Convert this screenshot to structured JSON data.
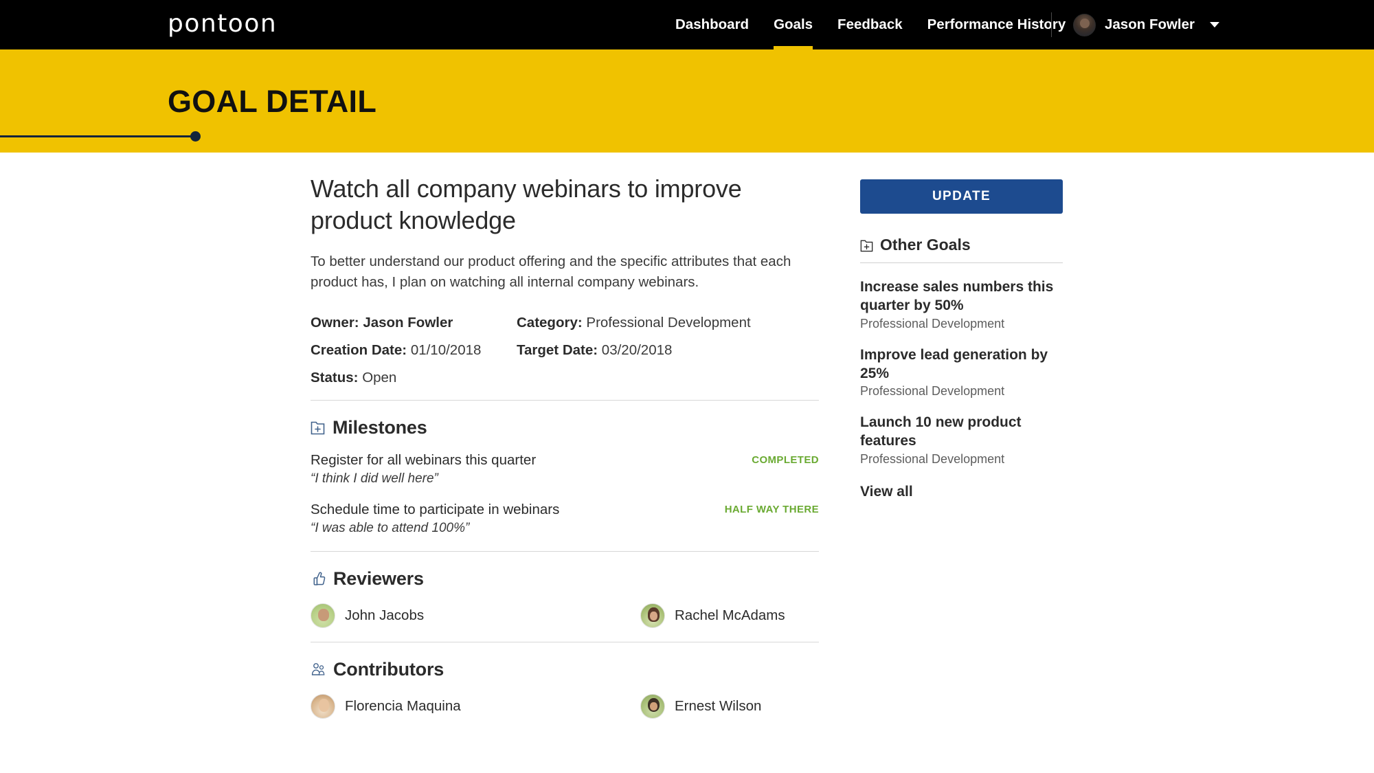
{
  "brand": {
    "logo_text": "pontoon"
  },
  "nav": {
    "items": [
      {
        "label": "Dashboard",
        "active": false
      },
      {
        "label": "Goals",
        "active": true
      },
      {
        "label": "Feedback",
        "active": false
      },
      {
        "label": "Performance History",
        "active": false
      }
    ],
    "user": {
      "name": "Jason Fowler",
      "avatar_icon": "user-avatar",
      "caret_icon": "chevron-down-icon"
    }
  },
  "banner": {
    "title": "GOAL DETAIL"
  },
  "goal": {
    "title": "Watch all company webinars to improve product knowledge",
    "description": "To better understand our product offering and the specific attributes that each product has, I plan on watching all internal company webinars.",
    "meta": {
      "owner_label": "Owner:",
      "owner_value": "Jason Fowler",
      "category_label": "Category:",
      "category_value": "Professional Development",
      "creation_label": "Creation Date:",
      "creation_value": "01/10/2018",
      "target_label": "Target Date:",
      "target_value": "03/20/2018",
      "status_label": "Status:",
      "status_value": "Open"
    }
  },
  "milestones": {
    "heading": "Milestones",
    "icon": "add-document-icon",
    "items": [
      {
        "title": "Register for all webinars this quarter",
        "quote": "“I think I did well here”",
        "status": "COMPLETED"
      },
      {
        "title": "Schedule time to participate in webinars",
        "quote": "“I was able to attend 100%”",
        "status": "HALF WAY THERE"
      }
    ]
  },
  "reviewers": {
    "heading": "Reviewers",
    "icon": "thumbs-up-icon",
    "items": [
      {
        "name": "John Jacobs"
      },
      {
        "name": "Rachel McAdams"
      }
    ]
  },
  "contributors": {
    "heading": "Contributors",
    "icon": "people-group-icon",
    "items": [
      {
        "name": "Florencia Maquina"
      },
      {
        "name": "Ernest Wilson"
      }
    ]
  },
  "sidebar": {
    "update_label": "UPDATE",
    "other_goals_heading": "Other Goals",
    "other_goals_icon": "add-document-icon",
    "goals": [
      {
        "title": "Increase sales numbers this quarter by 50%",
        "category": "Professional Development"
      },
      {
        "title": "Improve lead generation by 25%",
        "category": "Professional Development"
      },
      {
        "title": "Launch 10 new product features",
        "category": "Professional Development"
      }
    ],
    "view_all_label": "View all"
  },
  "colors": {
    "brand_yellow": "#F0C200",
    "nav_black": "#000000",
    "accent_blue": "#1D4B8F",
    "status_green": "#6AAA32",
    "progress_dark": "#12243B"
  }
}
